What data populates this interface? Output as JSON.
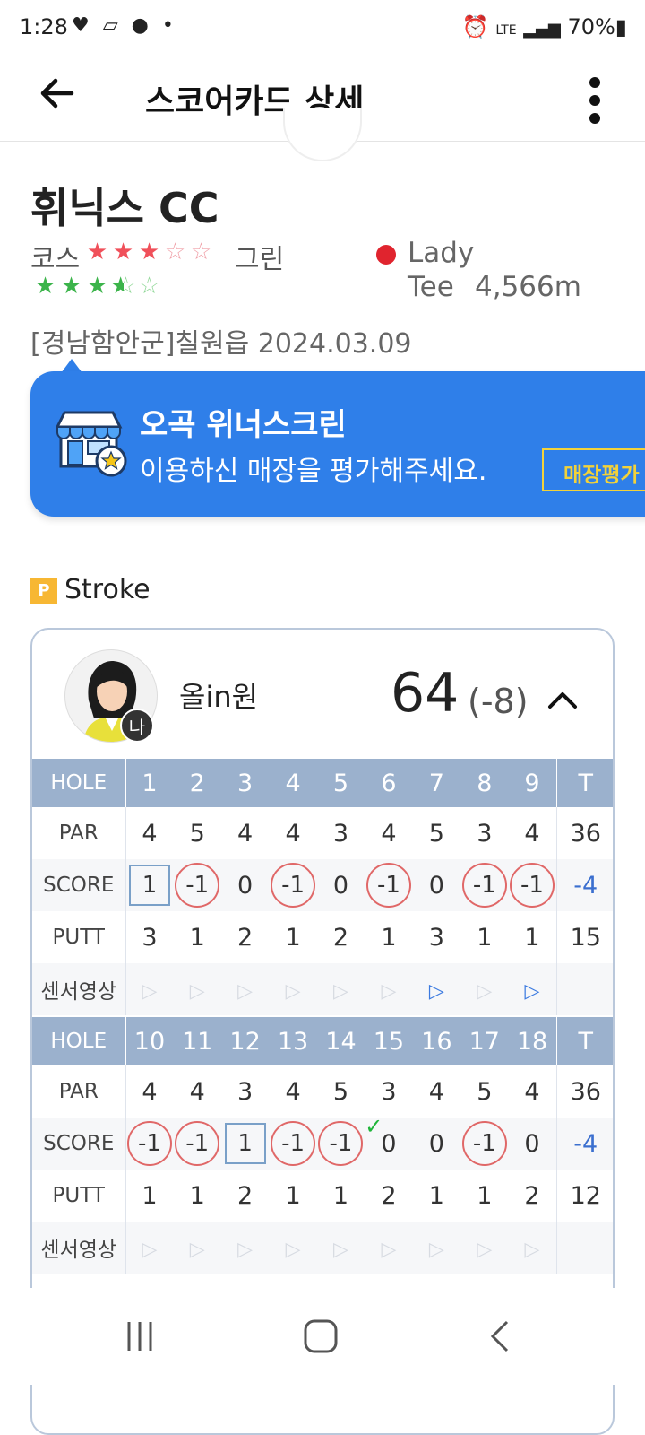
{
  "status": {
    "time": "1:28",
    "battery": "70%",
    "network": "LTE"
  },
  "appbar": {
    "title": "스코어카드 상세"
  },
  "club": {
    "name": "휘닉스 CC",
    "course_label": "코스",
    "green_label": "그린",
    "course_rating": 3,
    "green_rating": 3.5,
    "tee_name": "Lady",
    "tee_label": "Tee",
    "tee_distance": "4,566m",
    "tee_color": "#e0242e",
    "region_date": "[경남함안군]칠원읍 2024.03.09"
  },
  "store": {
    "name": "오곡 위너스크린",
    "message": "이용하신 매장을 평가해주세요.",
    "rate_button": "매장평가"
  },
  "mode": {
    "badge": "P",
    "label": "Stroke"
  },
  "player": {
    "name": "올in원",
    "me_badge": "나",
    "total": "64",
    "diff": "(-8)"
  },
  "labels": {
    "hole": "HOLE",
    "par": "PAR",
    "score": "SCORE",
    "putt": "PUTT",
    "video": "센서영상",
    "total": "T"
  },
  "front": {
    "holes": [
      "1",
      "2",
      "3",
      "4",
      "5",
      "6",
      "7",
      "8",
      "9"
    ],
    "par": [
      "4",
      "5",
      "4",
      "4",
      "3",
      "4",
      "5",
      "3",
      "4"
    ],
    "par_total": "36",
    "score": [
      "1",
      "-1",
      "0",
      "-1",
      "0",
      "-1",
      "0",
      "-1",
      "-1"
    ],
    "score_total": "-4",
    "score_style": [
      "box",
      "circle",
      "",
      "circle",
      "",
      "circle",
      "",
      "circle",
      "circle"
    ],
    "putt": [
      "3",
      "1",
      "2",
      "1",
      "2",
      "1",
      "3",
      "1",
      "1"
    ],
    "putt_total": "15",
    "video": [
      false,
      false,
      false,
      false,
      false,
      false,
      true,
      false,
      true
    ]
  },
  "back": {
    "holes": [
      "10",
      "11",
      "12",
      "13",
      "14",
      "15",
      "16",
      "17",
      "18"
    ],
    "par": [
      "4",
      "4",
      "3",
      "4",
      "5",
      "3",
      "4",
      "5",
      "4"
    ],
    "par_total": "36",
    "score": [
      "-1",
      "-1",
      "1",
      "-1",
      "-1",
      "0",
      "0",
      "-1",
      "0"
    ],
    "score_total": "-4",
    "score_style": [
      "circle",
      "circle",
      "box",
      "circle",
      "circle",
      "check",
      "",
      "circle",
      ""
    ],
    "putt": [
      "1",
      "1",
      "2",
      "1",
      "1",
      "2",
      "1",
      "1",
      "2"
    ],
    "putt_total": "12",
    "video": [
      false,
      false,
      false,
      false,
      false,
      false,
      false,
      false,
      false
    ]
  }
}
